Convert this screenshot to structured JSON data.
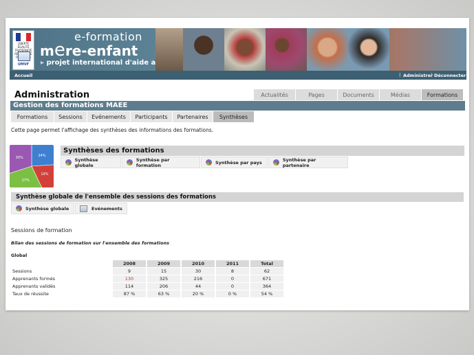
{
  "header": {
    "brand_line1": "e-formation",
    "brand_m": "m",
    "brand_e": "e",
    "brand_rest": "re-enfant",
    "brand_arrow": "▸",
    "tagline": "projet international d'aide aux pays du sud",
    "logo_rf": "LIBERTÉ ÉGALITÉ FRATERNITÉ RÉPUBLIQUE FRANÇAISE",
    "logo_umvf": "UMVF",
    "flag_colors": [
      "#1f3a93",
      "#ffffff",
      "#d8262e"
    ]
  },
  "navbar": {
    "accueil": "Accueil",
    "administrer": "Administrer",
    "deconnecter": "Déconnecter",
    "separator": "|"
  },
  "page_title": "Administration",
  "top_nav": [
    {
      "label": "Actualités",
      "active": false
    },
    {
      "label": "Pages",
      "active": false
    },
    {
      "label": "Documents",
      "active": false
    },
    {
      "label": "Médias",
      "active": false
    },
    {
      "label": "Formations",
      "active": true
    }
  ],
  "section_title": "Gestion des formations MAEE",
  "sub_tabs": [
    {
      "label": "Formations",
      "active": false
    },
    {
      "label": "Sessions",
      "active": false
    },
    {
      "label": "Evénements",
      "active": false
    },
    {
      "label": "Participants",
      "active": false
    },
    {
      "label": "Partenaires",
      "active": false
    },
    {
      "label": "Synthèses",
      "active": true
    }
  ],
  "intro_text": "Cette page permet l'affichage des synthèses des informations des formations.",
  "pie_chart": {
    "slices": [
      {
        "label": "24%",
        "value": 24,
        "color": "#3f7fcf"
      },
      {
        "label": "19%",
        "value": 19,
        "color": "#d2403a"
      },
      {
        "label": "27%",
        "value": 27,
        "color": "#7cc043"
      },
      {
        "label": "30%",
        "value": 30,
        "color": "#9a58b3"
      }
    ]
  },
  "syntheses": {
    "title": "Synthèses des formations",
    "buttons": [
      "Synthèse globale",
      "Synthèse par formation",
      "Synthèse par pays",
      "Synthèse par partenaire"
    ]
  },
  "globale": {
    "title": "Synthèse globale de l'ensemble des sessions des formations",
    "buttons": [
      "Synthèse globale",
      "Evénements"
    ]
  },
  "sessions_title": "Sessions de formation",
  "bilan_title": "Bilan des sessions de formation sur l'ensemble des formations",
  "global_label": "Global",
  "table": {
    "headers": [
      "2008",
      "2009",
      "2010",
      "2011",
      "Total"
    ],
    "rows": [
      {
        "label": "Sessions",
        "values": [
          "9",
          "15",
          "30",
          "8",
          "62"
        ]
      },
      {
        "label": "Apprenants formés",
        "values": [
          "130",
          "325",
          "216",
          "0",
          "671"
        ]
      },
      {
        "label": "Apprenants validés",
        "values": [
          "114",
          "206",
          "44",
          "0",
          "364"
        ]
      },
      {
        "label": "Taux de réussite",
        "values": [
          "87 %",
          "63 %",
          "20 %",
          "0 %",
          "54 %"
        ]
      }
    ]
  }
}
